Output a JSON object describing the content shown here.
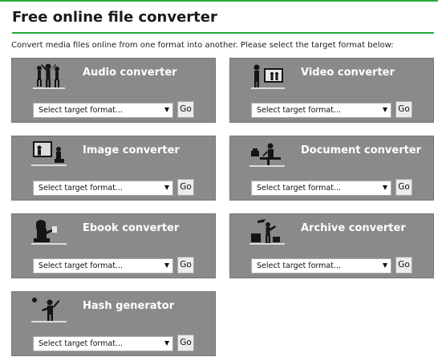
{
  "page": {
    "title": "Free online file converter",
    "intro": "Convert media files online from one format into another. Please select the target format below:"
  },
  "converters": [
    {
      "title": "Audio converter",
      "icon": "audio-people-icon",
      "select_value": "Select target format...",
      "go_label": "Go"
    },
    {
      "title": "Video converter",
      "icon": "video-person-icon",
      "select_value": "Select target format...",
      "go_label": "Go"
    },
    {
      "title": "Image converter",
      "icon": "image-frame-icon",
      "select_value": "Select target format...",
      "go_label": "Go"
    },
    {
      "title": "Document converter",
      "icon": "document-desk-icon",
      "select_value": "Select target format...",
      "go_label": "Go"
    },
    {
      "title": "Ebook converter",
      "icon": "ebook-reader-icon",
      "select_value": "Select target format...",
      "go_label": "Go"
    },
    {
      "title": "Archive converter",
      "icon": "archive-box-icon",
      "select_value": "Select target format...",
      "go_label": "Go"
    },
    {
      "title": "Hash generator",
      "icon": "hash-person-icon",
      "select_value": "Select target format...",
      "go_label": "Go"
    }
  ],
  "colors": {
    "accent_line": "#2aa83a",
    "card_background": "#8a8a8a",
    "card_title": "#ffffff"
  }
}
